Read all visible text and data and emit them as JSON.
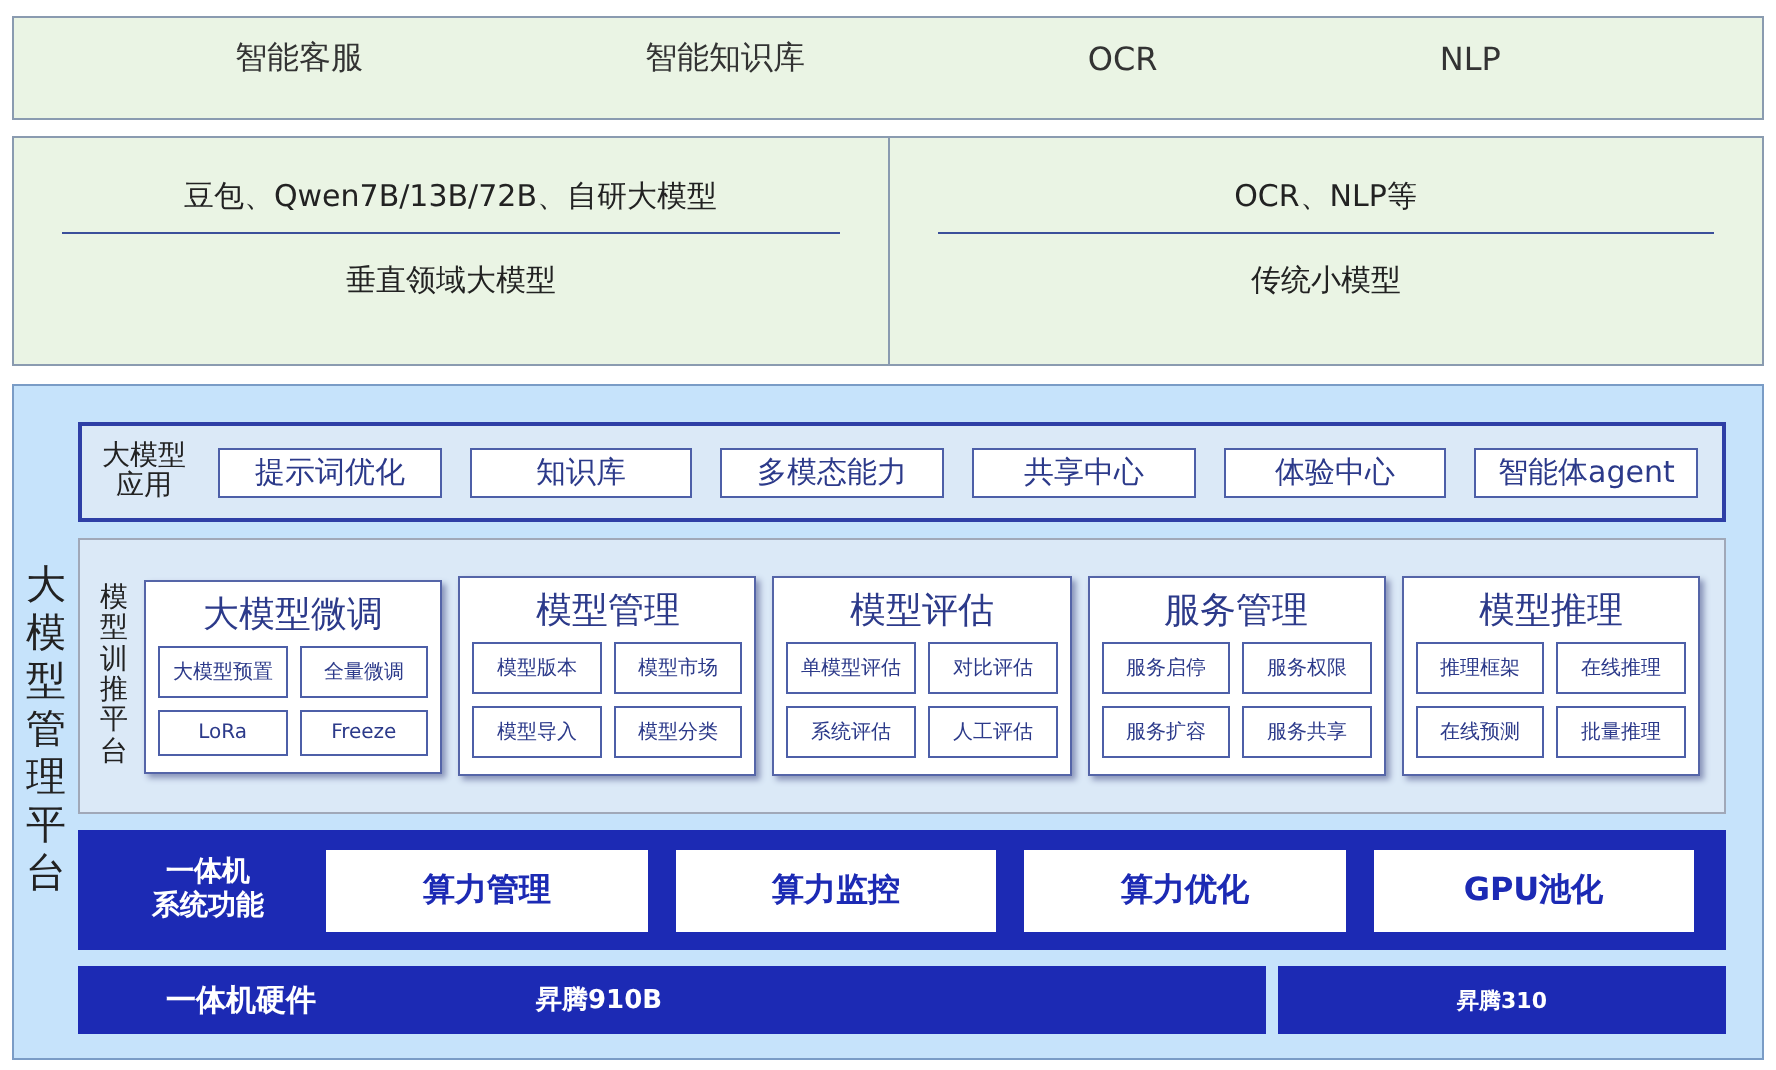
{
  "top_row": [
    "智能客服",
    "智能知识库",
    "OCR",
    "NLP"
  ],
  "model_row": [
    {
      "title": "豆包、Qwen7B/13B/72B、自研大模型",
      "subtitle": "垂直领域大模型"
    },
    {
      "title": "OCR、NLP等",
      "subtitle": "传统小模型"
    }
  ],
  "platform": {
    "title": "大模型管理平台",
    "apps": {
      "label": "大模型应用",
      "items": [
        "提示词优化",
        "知识库",
        "多模态能力",
        "共享中心",
        "体验中心",
        "智能体agent"
      ]
    },
    "training": {
      "label": "模型训推平台",
      "modules": [
        {
          "title": "大模型微调",
          "items": [
            "大模型预置",
            "全量微调",
            "LoRa",
            "Freeze"
          ]
        },
        {
          "title": "模型管理",
          "items": [
            "模型版本",
            "模型市场",
            "模型导入",
            "模型分类"
          ]
        },
        {
          "title": "模型评估",
          "items": [
            "单模型评估",
            "对比评估",
            "系统评估",
            "人工评估"
          ]
        },
        {
          "title": "服务管理",
          "items": [
            "服务启停",
            "服务权限",
            "服务扩容",
            "服务共享"
          ]
        },
        {
          "title": "模型推理",
          "items": [
            "推理框架",
            "在线推理",
            "在线预测",
            "批量推理"
          ]
        }
      ]
    },
    "system": {
      "label_lines": [
        "一体机",
        "系统功能"
      ],
      "items": [
        "算力管理",
        "算力监控",
        "算力优化",
        "GPU池化"
      ]
    },
    "hardware": {
      "label": "一体机硬件",
      "chips": [
        "昇腾910B",
        "昇腾310"
      ]
    }
  }
}
